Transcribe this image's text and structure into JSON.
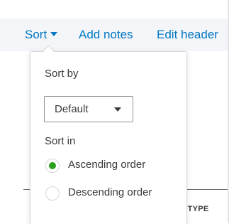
{
  "toolbar": {
    "sort_label": "Sort",
    "add_notes_label": "Add notes",
    "edit_header_label": "Edit header"
  },
  "table": {
    "column_header_partial": "N TYPE"
  },
  "sort_popover": {
    "sort_by_label": "Sort by",
    "sort_by_selected": "Default",
    "sort_in_label": "Sort in",
    "options": [
      {
        "label": "Ascending order",
        "selected": true
      },
      {
        "label": "Descending order",
        "selected": false
      }
    ]
  },
  "colors": {
    "link_blue": "#0077c5",
    "radio_selected_green": "#2ca01c",
    "text_dark": "#393a3d",
    "toolbar_bg": "#f4f5f8"
  },
  "icons": {
    "sort_caret": "caret-down-icon",
    "select_caret": "caret-down-icon"
  }
}
